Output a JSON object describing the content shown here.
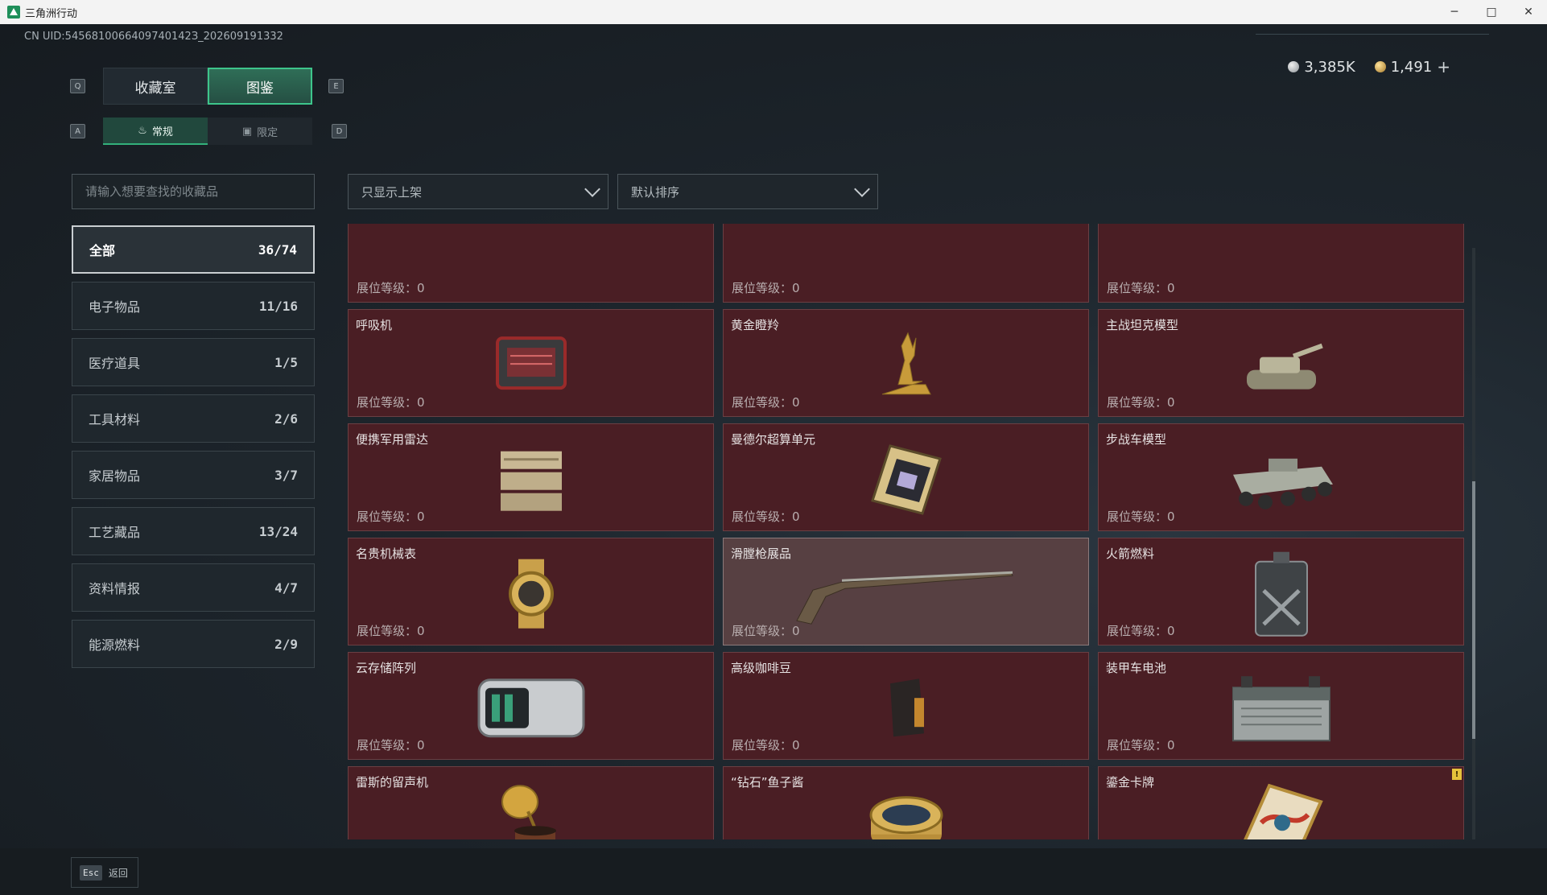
{
  "window": {
    "title": "三角洲行动",
    "minimize": "─",
    "maximize": "□",
    "close": "✕"
  },
  "uid": "CN UID:5456810066409740142З_202609191332",
  "currency": {
    "silver": "3,385K",
    "gold": "1,491",
    "add": "+"
  },
  "keys": {
    "q": "Q",
    "e": "E",
    "a": "A",
    "d": "D"
  },
  "top_tabs": [
    {
      "label": "收藏室"
    },
    {
      "label": "图鉴"
    }
  ],
  "sub_tabs": [
    {
      "label": "常规"
    },
    {
      "label": "限定"
    }
  ],
  "search": {
    "placeholder": "请输入想要查找的收藏品"
  },
  "filters": {
    "shelf": "只显示上架",
    "sort": "默认排序"
  },
  "categories": [
    {
      "label": "全部",
      "count": "36/74"
    },
    {
      "label": "电子物品",
      "count": "11/16"
    },
    {
      "label": "医疗道具",
      "count": "1/5"
    },
    {
      "label": "工具材料",
      "count": "2/6"
    },
    {
      "label": "家居物品",
      "count": "3/7"
    },
    {
      "label": "工艺藏品",
      "count": "13/24"
    },
    {
      "label": "资料情报",
      "count": "4/7"
    },
    {
      "label": "能源燃料",
      "count": "2/9"
    }
  ],
  "level_label": "展位等级：",
  "items": [
    {
      "name": "",
      "level": "0"
    },
    {
      "name": "",
      "level": "0"
    },
    {
      "name": "",
      "level": "0"
    },
    {
      "name": "呼吸机",
      "level": "0",
      "icon": "ventilator-icon"
    },
    {
      "name": "黄金瞪羚",
      "level": "0",
      "icon": "golden-gazelle-icon"
    },
    {
      "name": "主战坦克模型",
      "level": "0",
      "icon": "tank-model-icon"
    },
    {
      "name": "便携军用雷达",
      "level": "0",
      "icon": "radar-icon"
    },
    {
      "name": "曼德尔超算单元",
      "level": "0",
      "icon": "supercomputer-icon"
    },
    {
      "name": "步战车模型",
      "level": "0",
      "icon": "ifv-model-icon"
    },
    {
      "name": "名贵机械表",
      "level": "0",
      "icon": "watch-icon"
    },
    {
      "name": "滑膛枪展品",
      "level": "0",
      "icon": "musket-icon"
    },
    {
      "name": "火箭燃料",
      "level": "0",
      "icon": "fuel-can-icon"
    },
    {
      "name": "云存储阵列",
      "level": "0",
      "icon": "storage-array-icon"
    },
    {
      "name": "高级咖啡豆",
      "level": "0",
      "icon": "coffee-bag-icon"
    },
    {
      "name": "装甲车电池",
      "level": "0",
      "icon": "battery-icon"
    },
    {
      "name": "雷斯的留声机",
      "level": "0",
      "icon": "gramophone-icon"
    },
    {
      "name": "“钻石”鱼子酱",
      "level": "0",
      "icon": "caviar-icon"
    },
    {
      "name": "鎏金卡牌",
      "level": "0",
      "icon": "gold-card-icon"
    }
  ],
  "badge": "!",
  "back": {
    "key": "Esc",
    "label": "返回"
  },
  "colors": {
    "accent": "#3dc58b",
    "card_bg": "#4a1e24",
    "card_highlight": "#574042"
  }
}
